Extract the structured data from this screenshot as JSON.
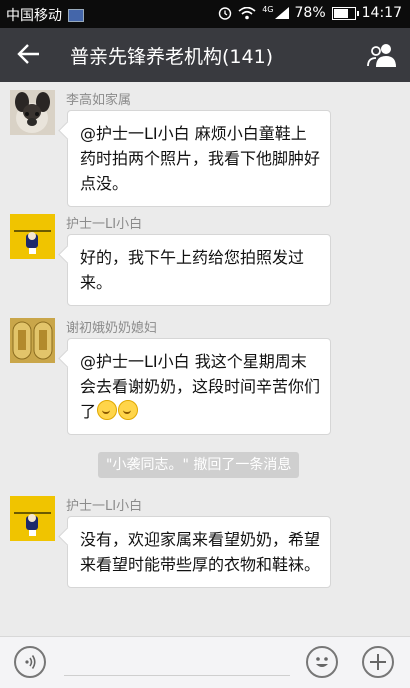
{
  "status_bar": {
    "carrier": "中国移动",
    "network": "4G",
    "battery": "78%",
    "battery_level": 0.78,
    "time": "14:17"
  },
  "header": {
    "title": "普亲先锋养老机构(141)"
  },
  "messages": [
    {
      "sender": "李高如家属",
      "text": "@护士一LI小白 麻烦小白童鞋上药时拍两个照片，我看下他脚肿好点没。"
    },
    {
      "sender": "护士一LI小白",
      "text": "好的，我下午上药给您拍照发过来。"
    },
    {
      "sender": "谢初娥奶奶媳妇",
      "text": "@护士一LI小白 我这个星期周末会去看谢奶奶，这段时间辛苦你们了"
    },
    {
      "sender": "护士一LI小白",
      "text": "没有，欢迎家属来看望奶奶，希望来看望时能带些厚的衣物和鞋袜。"
    }
  ],
  "system_notice": "\"小袭同志。\" 撤回了一条消息",
  "icons": {
    "back": "back-arrow-icon",
    "group": "group-people-icon",
    "voice": "voice-icon",
    "emoji": "emoji-icon",
    "plus": "plus-icon"
  },
  "colors": {
    "header_bg": "#393a3f",
    "chat_bg": "#ebebeb",
    "bubble_bg": "#ffffff"
  }
}
